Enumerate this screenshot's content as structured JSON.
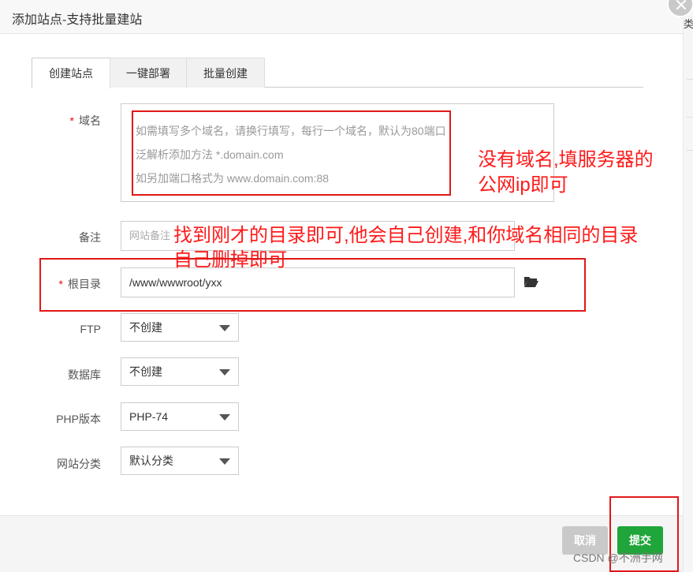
{
  "dialog": {
    "title": "添加站点-支持批量建站",
    "tabs": [
      {
        "label": "创建站点",
        "active": true
      },
      {
        "label": "一键部署",
        "active": false
      },
      {
        "label": "批量创建",
        "active": false
      }
    ]
  },
  "form": {
    "domain": {
      "required_mark": "*",
      "label": "域名",
      "placeholder_lines": [
        "如需填写多个域名，请换行填写，每行一个域名，默认为80端口",
        "泛解析添加方法 *.domain.com",
        "如另加端口格式为 www.domain.com:88"
      ]
    },
    "remark": {
      "label": "备注",
      "placeholder": "网站备注"
    },
    "root_dir": {
      "required_mark": "*",
      "label": "根目录",
      "value": "/www/wwwroot/yxx"
    },
    "ftp": {
      "label": "FTP",
      "selected": "不创建"
    },
    "database": {
      "label": "数据库",
      "selected": "不创建"
    },
    "php": {
      "label": "PHP版本",
      "selected": "PHP-74"
    },
    "category": {
      "label": "网站分类",
      "selected": "默认分类"
    }
  },
  "footer": {
    "cancel_label": "取消",
    "submit_label": "提交"
  },
  "annotations": {
    "domain_note_line1": "没有域名,填服务器的",
    "domain_note_line2": "公网ip即可",
    "root_note_line1": "找到刚才的目录即可,他会自己创建,和你域名相同的目录",
    "root_note_line2": "自己删掉即可"
  },
  "side_strip_text": "类",
  "watermark": "CSDN @不洲手网",
  "colors": {
    "accent": "#20a53a",
    "annotation": "#e01818",
    "required": "#ef0808"
  }
}
